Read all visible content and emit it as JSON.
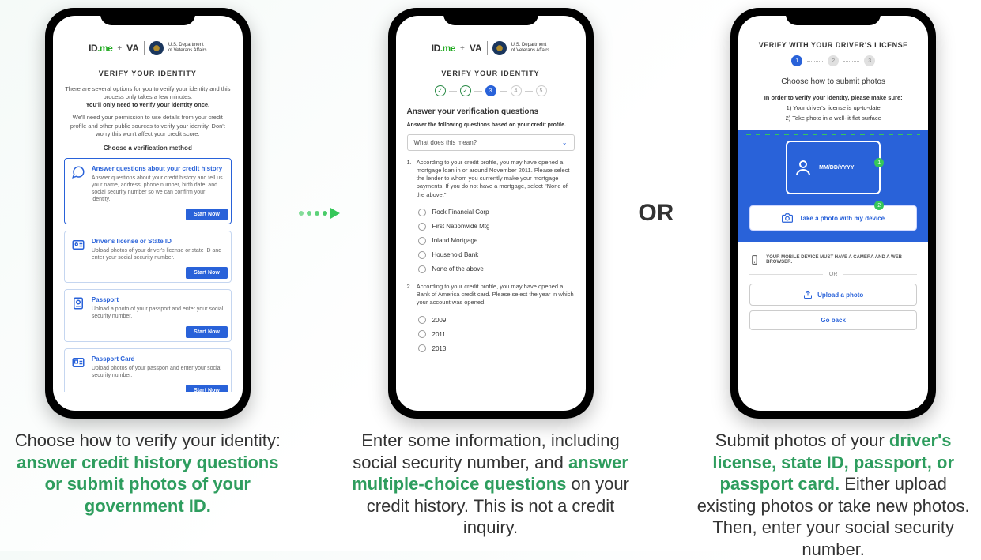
{
  "logos": {
    "idme": "ID.me",
    "plus": "+",
    "va": "VA",
    "dept1": "U.S. Department",
    "dept2": "of Veterans Affairs"
  },
  "phone1": {
    "title": "VERIFY YOUR IDENTITY",
    "p1a": "There are several options for you to verify your identity and this process only takes a few minutes.",
    "p1b": "You'll only need to verify your identity once.",
    "p2": "We'll need your permission to use details from your credit profile and other public sources to verify your identity. Don't worry this won't affect your credit score.",
    "choose": "Choose a verification method",
    "cards": [
      {
        "title": "Answer questions about your credit history",
        "desc": "Answer questions about your credit history and tell us your name, address, phone number, birth date, and social security number so we can confirm your identity.",
        "btn": "Start Now"
      },
      {
        "title": "Driver's license or State ID",
        "desc": "Upload photos of your driver's license or state ID and enter your social security number.",
        "btn": "Start Now"
      },
      {
        "title": "Passport",
        "desc": "Upload a photo of your passport and enter your social security number.",
        "btn": "Start Now"
      },
      {
        "title": "Passport Card",
        "desc": "Upload photos of your passport and enter your social security number.",
        "btn": "Start Now"
      }
    ]
  },
  "phone2": {
    "title": "VERIFY YOUR IDENTITY",
    "steps": [
      "✓",
      "✓",
      "3",
      "4",
      "5"
    ],
    "activeStep": 2,
    "heading": "Answer your verification questions",
    "sub": "Answer the following questions based on your credit profile.",
    "select": "What does this mean?",
    "q1num": "1.",
    "q1": "According to your credit profile, you may have opened a mortgage loan in or around November 2011. Please select the lender to whom you currently make your mortgage payments. If you do not have a mortgage, select \"None of the above.\"",
    "q1opts": [
      "Rock Financial Corp",
      "First Nationwide Mtg",
      "Inland Mortgage",
      "Household Bank",
      "None of the above"
    ],
    "q2num": "2.",
    "q2": "According to your credit profile, you may have opened a Bank of America credit card. Please select the year in which your account was opened.",
    "q2opts": [
      "2009",
      "2011",
      "2013"
    ]
  },
  "phone3": {
    "title": "VERIFY WITH YOUR DRIVER'S LICENSE",
    "steps": [
      "1",
      "2",
      "3"
    ],
    "heading": "Choose how to submit photos",
    "lead": "In order to verify your identity, please make sure:",
    "items": [
      "1) Your driver's license is up-to-date",
      "2) Take photo in a well-lit flat surface"
    ],
    "date": "MM/DD/YYYY",
    "dot1": "1",
    "dot2": "2",
    "takePhoto": "Take a photo with my device",
    "note": "YOUR MOBILE DEVICE MUST HAVE A CAMERA AND A WEB BROWSER.",
    "or": "OR",
    "upload": "Upload a photo",
    "back": "Go back"
  },
  "connectors": {
    "or": "OR"
  },
  "captions": {
    "c1a": "Choose how to verify your identity: ",
    "c1b": "answer credit history questions or submit photos of your government ID.",
    "c2a": "Enter some information, including social security number, and ",
    "c2b": "answer multiple-choice questions",
    "c2c": " on your credit history. This is not a credit inquiry.",
    "c3a": "Submit photos of your ",
    "c3b": "driver's license, state ID, passport, or passport card.",
    "c3c": " Either upload existing photos or take new photos. Then, enter your social security number."
  }
}
